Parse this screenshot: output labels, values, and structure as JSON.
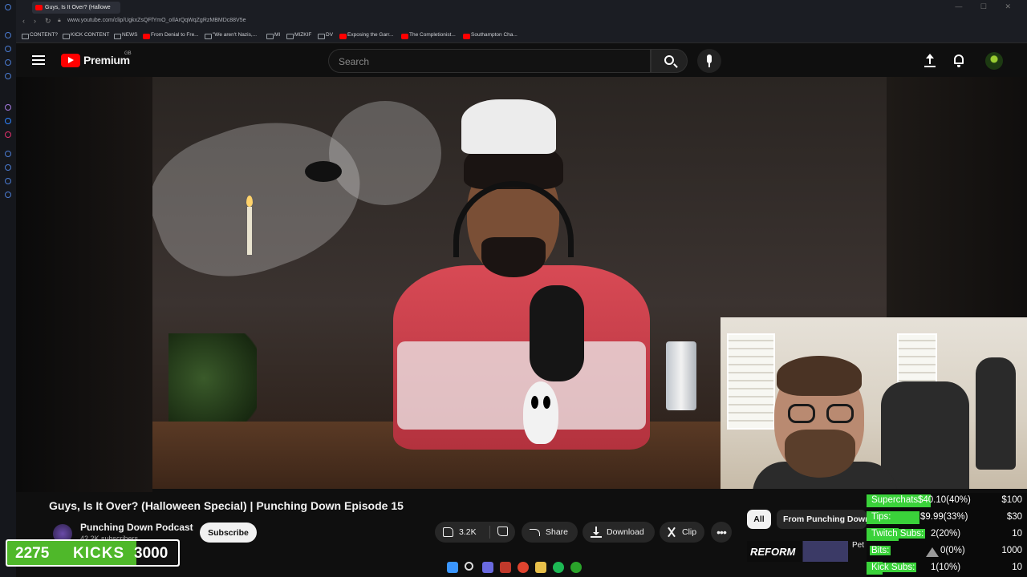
{
  "browser": {
    "tab_title": "Guys, Is It Over? (Hallowe",
    "url": "www.youtube.com/clip/UgkxZsQFfYmO_oIlArQqWqZgRzMBMDc88V5e",
    "bookmarks": [
      {
        "label": "CONTENT?",
        "type": "folder"
      },
      {
        "label": "KICK CONTENT",
        "type": "folder"
      },
      {
        "label": "NEWS",
        "type": "folder"
      },
      {
        "label": "From Denial to Fre...",
        "type": "youtube"
      },
      {
        "label": "\"We aren't Nazis,...",
        "type": "site"
      },
      {
        "label": "MI",
        "type": "folder"
      },
      {
        "label": "MIZKIF",
        "type": "folder"
      },
      {
        "label": "DV",
        "type": "folder"
      },
      {
        "label": "Exposing the Garr...",
        "type": "youtube"
      },
      {
        "label": "The Completionist...",
        "type": "youtube"
      },
      {
        "label": "Southampton Cha...",
        "type": "youtube"
      }
    ]
  },
  "header": {
    "logo_text": "Premium",
    "region": "GB",
    "search_placeholder": "Search"
  },
  "video": {
    "title": "Guys, Is It Over? (Halloween Special) | Punching Down Episode 15",
    "channel_name": "Punching Down Podcast",
    "channel_subs": "42.2K subscribers",
    "subscribe_label": "Subscribe",
    "like_count": "3.2K",
    "share_label": "Share",
    "download_label": "Download",
    "clip_label": "Clip",
    "more_label": "•••"
  },
  "sidebar_chips": {
    "all": "All",
    "from_channel": "From Punching Down"
  },
  "recommended": {
    "thumb_text": "REFORM",
    "title_partial": "Pet"
  },
  "kicks_widget": {
    "current": "2275",
    "label": "KICKS",
    "goal": "3000",
    "progress": 0.758,
    "color": "#4fb82a"
  },
  "donations": [
    {
      "label": "Superchats:",
      "value": "$40.10(40%)",
      "goal": "$100",
      "progress": 0.4
    },
    {
      "label": "Tips:",
      "value": "$9.99(33%)",
      "goal": "$30",
      "progress": 0.33
    },
    {
      "label": "Twitch Subs:",
      "value": "2(20%)",
      "goal": "10",
      "progress": 0.2
    },
    {
      "label": "Bits:",
      "value": "0(0%)",
      "goal": "1000",
      "progress": 0.0
    },
    {
      "label": "Kick Subs:",
      "value": "1(10%)",
      "goal": "10",
      "progress": 0.1
    }
  ],
  "colors": {
    "youtube_red": "#ff0000",
    "donation_bar": "#3ad23a",
    "kick_green": "#53fc18"
  }
}
